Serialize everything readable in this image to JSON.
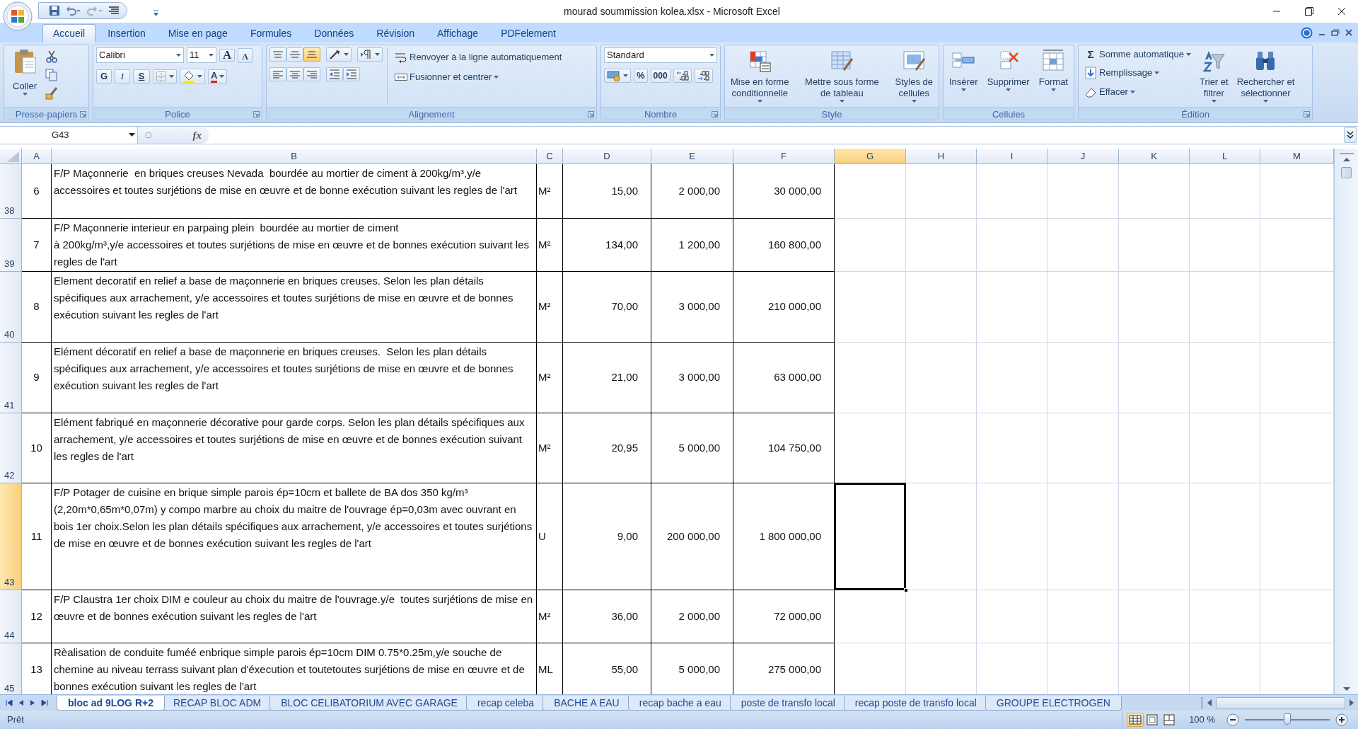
{
  "window": {
    "title": "mourad  soummission kolea.xlsx - Microsoft Excel"
  },
  "ribbon_tabs": [
    {
      "label": "Accueil",
      "selected": true
    },
    {
      "label": "Insertion",
      "selected": false
    },
    {
      "label": "Mise en page",
      "selected": false
    },
    {
      "label": "Formules",
      "selected": false
    },
    {
      "label": "Données",
      "selected": false
    },
    {
      "label": "Révision",
      "selected": false
    },
    {
      "label": "Affichage",
      "selected": false
    },
    {
      "label": "PDFelement",
      "selected": false
    }
  ],
  "clipboard": {
    "label": "Presse-papiers",
    "paste": "Coller"
  },
  "font": {
    "label": "Police",
    "name": "Calibri",
    "size": "11",
    "grow": "A",
    "shrink": "A",
    "bold": "G",
    "italic": "I",
    "underline": "S",
    "font_color": "A"
  },
  "alignment": {
    "label": "Alignement",
    "vertical": [
      {
        "selected": false
      },
      {
        "selected": false
      },
      {
        "selected": true
      }
    ],
    "wrap": "Renvoyer à la ligne automatiquement",
    "merge": "Fusionner et centrer"
  },
  "number": {
    "label": "Nombre",
    "format": "Standard",
    "percent": "%",
    "thousands": "000"
  },
  "styles": {
    "label": "Style",
    "buttons": [
      "Mise en forme\nconditionnelle",
      "Mettre sous forme\nde tableau",
      "Styles de\ncellules"
    ]
  },
  "cells": {
    "label": "Cellules",
    "buttons": [
      "Insérer",
      "Supprimer",
      "Format"
    ]
  },
  "editing": {
    "label": "Édition",
    "sigma": "Σ",
    "autosum": "Somme automatique",
    "fill": "Remplissage",
    "clear": "Effacer",
    "sort": "Trier et\nfiltrer",
    "find": "Rechercher et\nsélectionner"
  },
  "formula_bar": {
    "name_box": "G43",
    "fx": "fx"
  },
  "sheet": {
    "columns": [
      {
        "label": "A",
        "selected": false
      },
      {
        "label": "B",
        "selected": false
      },
      {
        "label": "C",
        "selected": false
      },
      {
        "label": "D",
        "selected": false
      },
      {
        "label": "E",
        "selected": false
      },
      {
        "label": "F",
        "selected": false
      },
      {
        "label": "G",
        "selected": true
      },
      {
        "label": "H",
        "selected": false
      },
      {
        "label": "I",
        "selected": false
      },
      {
        "label": "J",
        "selected": false
      },
      {
        "label": "K",
        "selected": false
      },
      {
        "label": "L",
        "selected": false
      },
      {
        "label": "M",
        "selected": false
      }
    ],
    "rows": [
      {
        "number": "38",
        "selected": false,
        "cells": [
          "6",
          "F/P Maçonnerie  en briques creuses Nevada  bourdée au mortier de ciment à 200kg/m³,y/e accessoires et toutes surjétions de mise en œuvre et de bonne exécution suivant les regles de l'art",
          "M²",
          "15,00",
          "2 000,00",
          "30 000,00"
        ]
      },
      {
        "number": "39",
        "selected": false,
        "cells": [
          "7",
          "F/P Maçonnerie interieur en parpaing plein  bourdée au mortier de ciment\nà 200kg/m³,y/e accessoires et toutes surjétions de mise en œuvre et de bonnes exécution suivant les regles de l'art",
          "M²",
          "134,00",
          "1 200,00",
          "160 800,00"
        ]
      },
      {
        "number": "40",
        "selected": false,
        "cells": [
          "8",
          "Element decoratif en relief a base de maçonnerie en briques creuses. Selon les plan détails spécifiques aux arrachement, y/e accessoires et toutes surjétions de mise en œuvre et de bonnes exécution suivant les regles de l'art",
          "M²",
          "70,00",
          "3 000,00",
          "210 000,00"
        ]
      },
      {
        "number": "41",
        "selected": false,
        "cells": [
          "9",
          "Elément décoratif en relief a base de maçonnerie en briques creuses.  Selon les plan détails spécifiques aux arrachement, y/e accessoires et toutes surjétions de mise en œuvre et de bonnes exécution suivant les regles de l'art",
          "M²",
          "21,00",
          "3 000,00",
          "63 000,00"
        ]
      },
      {
        "number": "42",
        "selected": false,
        "cells": [
          "10",
          "Elément fabriqué en maçonnerie décorative pour garde corps. Selon les plan détails spécifiques aux arrachement, y/e accessoires et toutes surjétions de mise en œuvre et de bonnes exécution suivant les regles de l'art",
          "M²",
          "20,95",
          "5 000,00",
          "104 750,00"
        ]
      },
      {
        "number": "43",
        "selected": true,
        "cells": [
          "11",
          "F/P Potager de cuisine en brique simple parois ép=10cm et ballete de BA dos 350 kg/m³ (2,20m*0,65m*0,07m) y compo marbre au choix du maitre de l'ouvrage ép=0,03m avec ouvrant en bois 1er choix.Selon les plan détails spécifiques aux arrachement, y/e accessoires et toutes surjétions de mise en œuvre et de bonnes exécution suivant les regles de l'art",
          "U",
          "9,00",
          "200 000,00",
          "1 800 000,00"
        ]
      },
      {
        "number": "44",
        "selected": false,
        "cells": [
          "12",
          "F/P Claustra 1er choix DIM e couleur au choix du maitre de l'ouvrage.y/e  toutes surjétions de mise en œuvre et de bonnes exécution suivant les regles de l'art",
          "M²",
          "36,00",
          "2 000,00",
          "72 000,00"
        ]
      },
      {
        "number": "45",
        "selected": false,
        "cells": [
          "13",
          "Rèalisation de conduite fuméé enbrique simple parois ép=10cm DIM 0.75*0.25m,y/e souche de chemine au niveau terrass suivant plan d'éxecution et toutetoutes surjétions de mise en œuvre et de bonnes exécution suivant les regles de l'art",
          "ML",
          "55,00",
          "5 000,00",
          "275 000,00"
        ]
      }
    ]
  },
  "sheet_tabs": [
    {
      "label": "bloc ad 9LOG R+2",
      "selected": true
    },
    {
      "label": "RECAP BLOC ADM",
      "selected": false
    },
    {
      "label": "BLOC CELIBATORIUM AVEC GARAGE",
      "selected": false
    },
    {
      "label": "recap celeba",
      "selected": false
    },
    {
      "label": "BACHE A EAU",
      "selected": false
    },
    {
      "label": "recap bache a eau",
      "selected": false
    },
    {
      "label": "poste de transfo local",
      "selected": false
    },
    {
      "label": "recap poste de transfo local",
      "selected": false
    },
    {
      "label": "GROUPE ELECTROGEN",
      "selected": false
    }
  ],
  "status_bar": {
    "status": "Prêt",
    "views": [
      {
        "selected": true
      },
      {
        "selected": false
      },
      {
        "selected": false
      }
    ],
    "zoom": "100 %",
    "zoom_slider": {
      "level": 0.5
    }
  }
}
